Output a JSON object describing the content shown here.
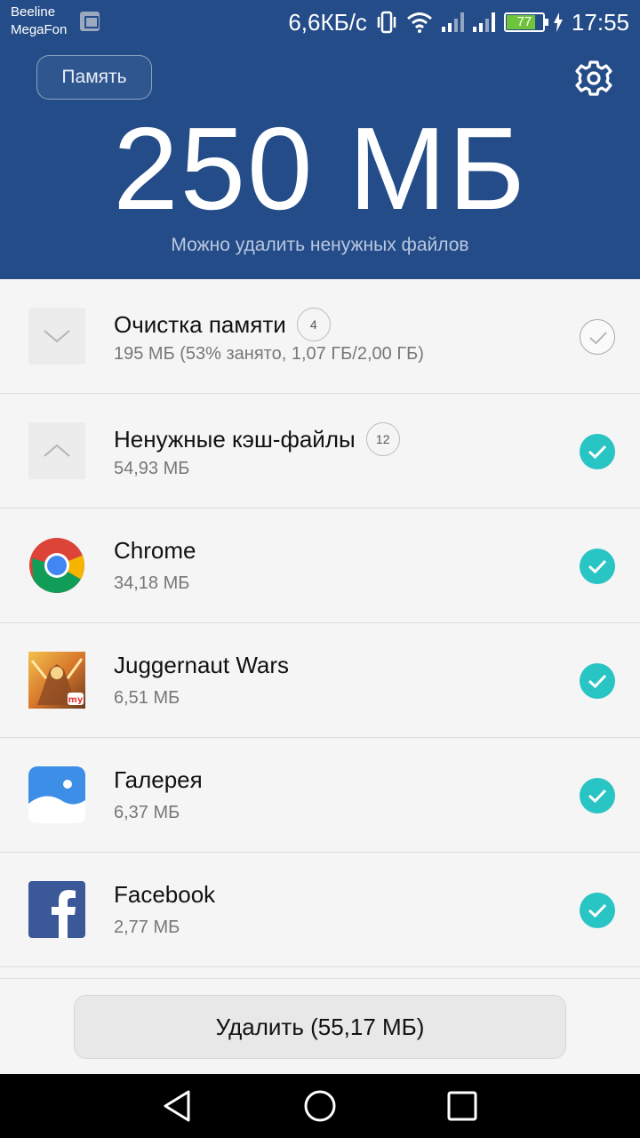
{
  "status_bar": {
    "carrier1": "Beeline",
    "carrier2": "MegaFon",
    "speed": "6,6КБ/с",
    "battery": "77",
    "time": "17:55"
  },
  "header": {
    "memory_button": "Память",
    "big_value": "250 МБ",
    "subtitle": "Можно удалить ненужных файлов"
  },
  "items": [
    {
      "title": "Очистка памяти",
      "count": "4",
      "size": "195 МБ (53% занято, 1,07 ГБ/2,00 ГБ)",
      "checked": false,
      "icon": "chevron-down-icon"
    },
    {
      "title": "Ненужные кэш-файлы",
      "count": "12",
      "size": "54,93 МБ",
      "checked": true,
      "icon": "chevron-up-icon"
    },
    {
      "title": "Chrome",
      "size": "34,18 МБ",
      "checked": true,
      "icon": "chrome-icon"
    },
    {
      "title": "Juggernaut Wars",
      "size": "6,51 МБ",
      "checked": true,
      "icon": "juggernaut-wars-icon"
    },
    {
      "title": "Галерея",
      "size": "6,37 МБ",
      "checked": true,
      "icon": "gallery-icon"
    },
    {
      "title": "Facebook",
      "size": "2,77 МБ",
      "checked": true,
      "icon": "facebook-icon"
    }
  ],
  "delete_button": "Удалить (55,17 МБ)",
  "colors": {
    "header_bg": "#244c88",
    "check_on": "#29c4c4",
    "battery_green": "#6ec43a"
  }
}
